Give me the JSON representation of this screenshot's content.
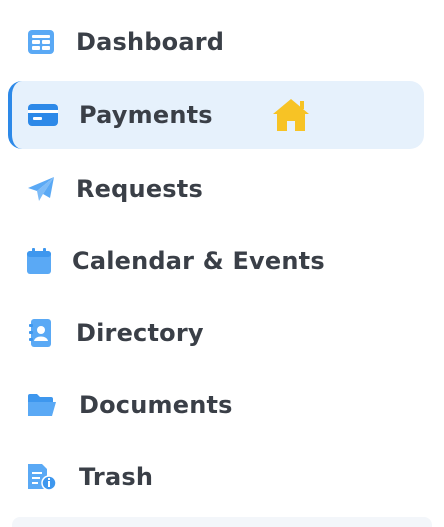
{
  "nav": {
    "items": [
      {
        "label": "Dashboard",
        "icon": "dashboard-icon",
        "active": false
      },
      {
        "label": "Payments",
        "icon": "credit-card-icon",
        "active": true
      },
      {
        "label": "Requests",
        "icon": "paper-plane-icon",
        "active": false
      },
      {
        "label": "Calendar & Events",
        "icon": "calendar-icon",
        "active": false
      },
      {
        "label": "Directory",
        "icon": "contact-book-icon",
        "active": false
      },
      {
        "label": "Documents",
        "icon": "folder-open-icon",
        "active": false
      },
      {
        "label": "Trash",
        "icon": "document-info-icon",
        "active": false
      }
    ]
  },
  "colors": {
    "icon_blue": "#5aa9f5",
    "active_bg": "#e6f1fc",
    "active_border": "#2d89e8",
    "label_text": "#3a3f47",
    "home_badge": "#f7c325"
  },
  "home_badge_icon": "home-icon"
}
